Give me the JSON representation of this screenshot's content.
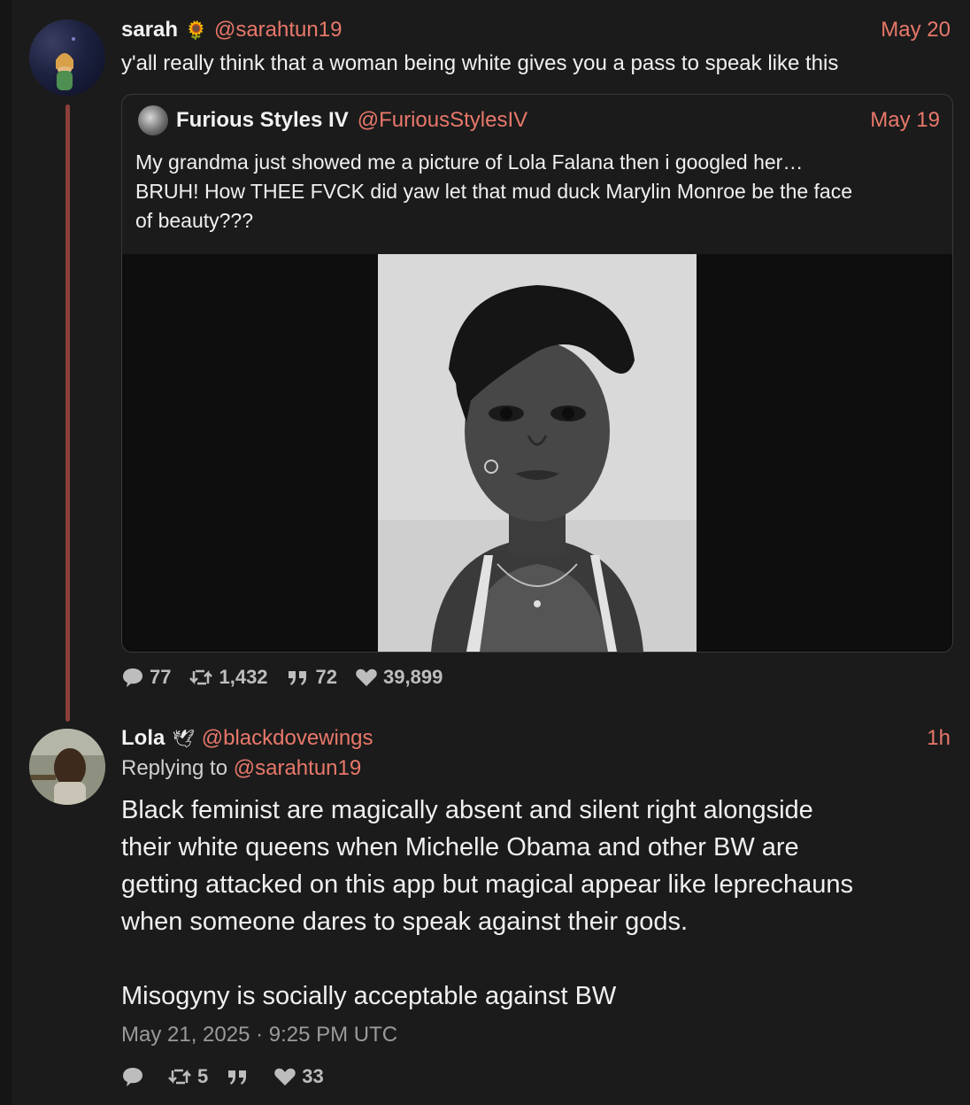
{
  "main_tweet": {
    "name": "sarah",
    "name_emoji": "🌻",
    "handle": "@sarahtun19",
    "date": "May 20",
    "text": "y'all really think that a woman being white gives you a pass to speak like this",
    "stats": {
      "replies": "77",
      "retweets": "1,432",
      "quotes": "72",
      "likes": "39,899"
    }
  },
  "quoted_tweet": {
    "name": "Furious Styles IV",
    "handle": "@FuriousStylesIV",
    "date": "May 19",
    "text_line1": "My grandma just showed me a picture of Lola Falana then i googled her…",
    "text_line2": "BRUH! How THEE FVCK did yaw let that mud duck Marylin Monroe be the face",
    "text_line3": "of beauty???"
  },
  "reply_tweet": {
    "name": "Lola",
    "name_emoji": "🕊",
    "handle": "@blackdovewings",
    "date": "1h",
    "replying_prefix": "Replying to",
    "replying_handle": "@sarahtun19",
    "text_line1": "Black feminist are magically absent and silent right alongside",
    "text_line2": "their white queens when Michelle Obama and other BW are",
    "text_line3": "getting attacked on this app but magical appear like leprechauns",
    "text_line4": "when someone dares to speak against their gods.",
    "text_line5": "Misogyny is socially acceptable against BW",
    "timestamp": "May 21, 2025 · 9:25 PM UTC",
    "stats": {
      "retweets": "5",
      "likes": "33"
    }
  },
  "colors": {
    "accent": "#e8786a",
    "thread_line": "#8a3f3a",
    "background": "#1b1b1b"
  }
}
